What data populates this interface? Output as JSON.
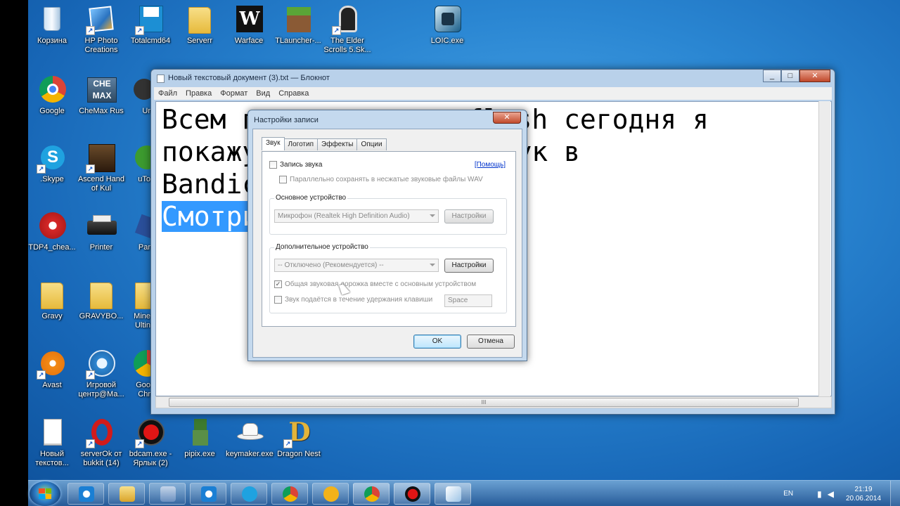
{
  "desktop": {
    "icons": [
      {
        "label": "Корзина",
        "icon": "recycle-bin-icon"
      },
      {
        "label": "HP Photo Creations",
        "icon": "hp-photo-icon"
      },
      {
        "label": "Totalcmd64",
        "icon": "floppy-icon"
      },
      {
        "label": "Serverr",
        "icon": "folder-icon"
      },
      {
        "label": "Warface",
        "icon": "warface-icon"
      },
      {
        "label": "TLauncher-...",
        "icon": "minecraft-grass-icon"
      },
      {
        "label": "The Elder Scrolls 5.Sk...",
        "icon": "skyrim-icon"
      },
      {
        "label": "LOIC.exe",
        "icon": "loic-icon"
      },
      {
        "label": "Google",
        "icon": "chrome-icon"
      },
      {
        "label": "CheMax Rus",
        "icon": "chemax-icon"
      },
      {
        "label": "Ur",
        "icon": "arrow-icon"
      },
      {
        "label": ".Skype",
        "icon": "skype-icon"
      },
      {
        "label": "Ascend Hand of Kul",
        "icon": "ascend-icon"
      },
      {
        "label": "uTo",
        "icon": "utorrent-icon"
      },
      {
        "label": "TDP4_chea...",
        "icon": "tdp4-icon"
      },
      {
        "label": "Printer",
        "icon": "printer-icon"
      },
      {
        "label": "Par",
        "icon": "partial-icon"
      },
      {
        "label": "Gravy",
        "icon": "folder-icon"
      },
      {
        "label": "GRAVYBO...",
        "icon": "folder-icon"
      },
      {
        "label": "Mine Ultin",
        "icon": "folder-icon"
      },
      {
        "label": "Avast",
        "icon": "avast-icon"
      },
      {
        "label": "Игровой центр@Ма...",
        "icon": "game-center-icon"
      },
      {
        "label": "Goo Chr",
        "icon": "chrome-icon"
      },
      {
        "label": "Новый текстов...",
        "icon": "text-document-icon"
      },
      {
        "label": "serverOk от bukkit (14)",
        "icon": "opera-icon"
      },
      {
        "label": "bdcam.exe - Ярлык (2)",
        "icon": "bandicam-icon"
      },
      {
        "label": "pipix.exe",
        "icon": "minecraft-character-icon"
      },
      {
        "label": "keymaker.exe",
        "icon": "keymaker-hat-icon"
      },
      {
        "label": "Dragon Nest",
        "icon": "dragon-nest-icon"
      }
    ]
  },
  "notepad": {
    "title": "Новый текстовый документ (3).txt — Блокнот",
    "menu": [
      "Файл",
      "Правка",
      "Формат",
      "Вид",
      "Справка"
    ],
    "lines": [
      "Всем привет с вами flash сегодня я",
      "покажу как записать звук в",
      "Bandicam",
      "Смотрите и повторяйте"
    ],
    "scroll_thumb": "III"
  },
  "dialog": {
    "title": "Настройки записи",
    "tabs": [
      "Звук",
      "Логотип",
      "Эффекты",
      "Опции"
    ],
    "record_sound": "Запись звука",
    "help_link": "[Помощь]",
    "save_wav": "Параллельно сохранять в несжатые звуковые файлы WAV",
    "primary_group": "Основное устройство",
    "primary_device": "Микрофон (Realtek High Definition Audio)",
    "secondary_group": "Дополнительное устройство",
    "secondary_device": "-- Отключено (Рекомендуется) --",
    "settings_btn": "Настройки",
    "mix_track": "Общая звуковая дорожка вместе с основным устройством",
    "hold_key": "Звук подаётся в течение удержания клавиши",
    "hold_key_value": "Space",
    "ok": "OK",
    "cancel": "Отмена"
  },
  "taskbar": {
    "lang": "EN",
    "time": "21:19",
    "date": "20.06.2014"
  }
}
